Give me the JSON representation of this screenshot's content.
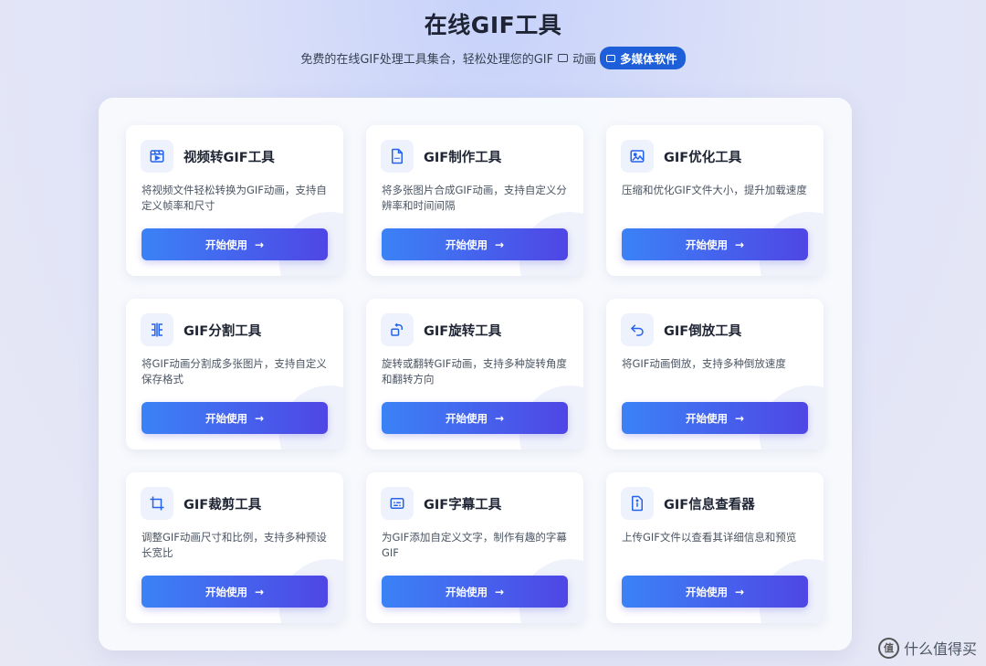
{
  "header": {
    "title": "在线GIF工具",
    "subtitle_text": "免费的在线GIF处理工具集合，轻松处理您的GIF",
    "subtitle_suffix": "动画",
    "badge_label": "多媒体软件"
  },
  "cards": [
    {
      "title": "视频转GIF工具",
      "desc": "将视频文件轻松转换为GIF动画，支持自定义帧率和尺寸",
      "button": "开始使用",
      "icon": "video-icon"
    },
    {
      "title": "GIF制作工具",
      "desc": "将多张图片合成GIF动画，支持自定义分辨率和时间间隔",
      "button": "开始使用",
      "icon": "gif-file-icon"
    },
    {
      "title": "GIF优化工具",
      "desc": "压缩和优化GIF文件大小，提升加载速度",
      "button": "开始使用",
      "icon": "image-icon"
    },
    {
      "title": "GIF分割工具",
      "desc": "将GIF动画分割成多张图片，支持自定义保存格式",
      "button": "开始使用",
      "icon": "split-icon"
    },
    {
      "title": "GIF旋转工具",
      "desc": "旋转或翻转GIF动画，支持多种旋转角度和翻转方向",
      "button": "开始使用",
      "icon": "rotate-icon"
    },
    {
      "title": "GIF倒放工具",
      "desc": "将GIF动画倒放，支持多种倒放速度",
      "button": "开始使用",
      "icon": "undo-icon"
    },
    {
      "title": "GIF裁剪工具",
      "desc": "调整GIF动画尺寸和比例，支持多种预设长宽比",
      "button": "开始使用",
      "icon": "crop-icon"
    },
    {
      "title": "GIF字幕工具",
      "desc": "为GIF添加自定义文字，制作有趣的字幕GIF",
      "button": "开始使用",
      "icon": "subtitle-icon"
    },
    {
      "title": "GIF信息查看器",
      "desc": "上传GIF文件以查看其详细信息和预览",
      "button": "开始使用",
      "icon": "info-icon"
    }
  ],
  "watermark": {
    "logo_text": "值",
    "text": "什么值得买"
  },
  "colors": {
    "accent": "#3b82f6",
    "accent_end": "#4f46e5",
    "badge": "#1e5fd9",
    "icon": "#2563eb"
  }
}
